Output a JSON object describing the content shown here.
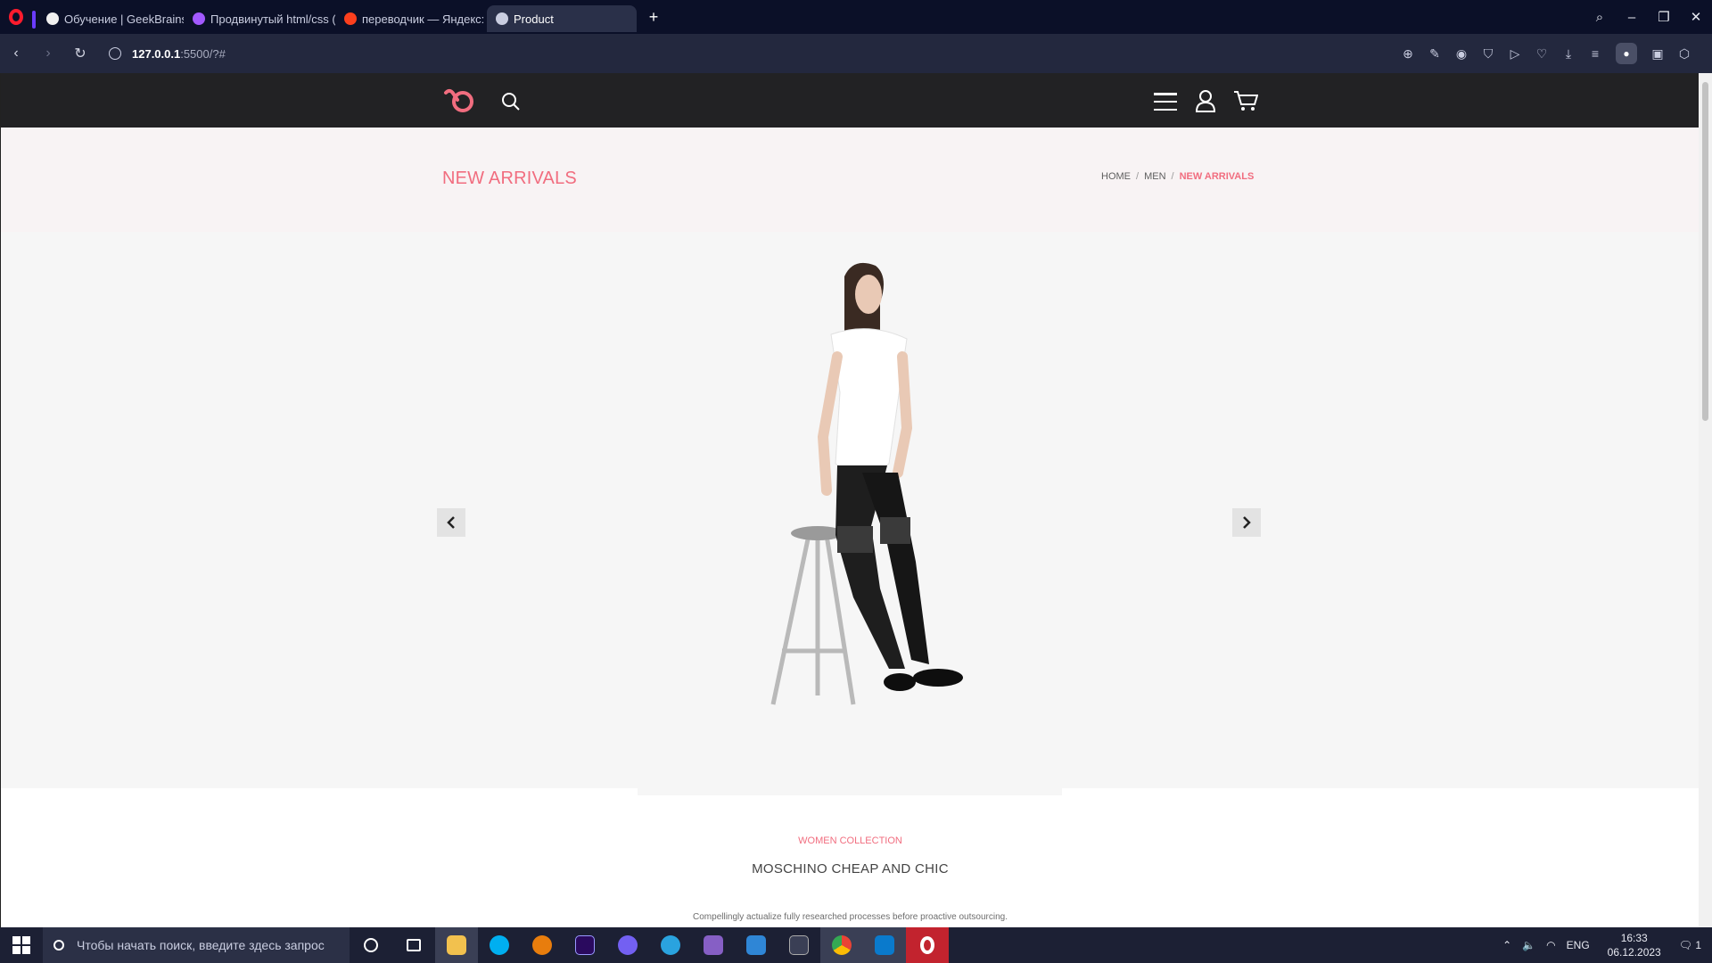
{
  "browser": {
    "tabs": [
      {
        "title": "Обучение | GeekBrains - о",
        "color": "#f0f0f0"
      },
      {
        "title": "Продвинутый html/css (С",
        "color": "#a259ff"
      },
      {
        "title": "переводчик — Яндекс: н",
        "color": "#fc3f1d"
      },
      {
        "title": "Product",
        "color": "#c9cde0",
        "active": true
      }
    ],
    "url_host": "127.0.0.1",
    "url_rest": ":5500/?#",
    "new_tab_label": "+"
  },
  "site": {
    "page_title": "NEW ARRIVALS",
    "breadcrumb": [
      {
        "label": "HOME"
      },
      {
        "label": "MEN"
      },
      {
        "label": "NEW ARRIVALS",
        "current": true
      }
    ],
    "breadcrumb_separator": "/",
    "accent_color": "#f16d7f",
    "header_color": "#222224",
    "hero": {
      "prev_icon": "chevron-left-icon",
      "next_icon": "chevron-right-icon"
    },
    "collection": {
      "label": "WOMEN COLLECTION",
      "title": "MOSCHINO CHEAP AND CHIC",
      "description": "Compellingly actualize fully researched processes before proactive outsourcing."
    }
  },
  "taskbar": {
    "search_placeholder": "Чтобы начать поиск, введите здесь запрос",
    "language": "ENG",
    "time": "16:33",
    "date": "06.12.2023",
    "apps": [
      {
        "name": "cortana-icon",
        "color": "#1c2034"
      },
      {
        "name": "task-view-icon",
        "color": "#1c2034"
      },
      {
        "name": "file-explorer-icon",
        "color": "#f2c14e"
      },
      {
        "name": "skype-icon",
        "color": "#00aff0"
      },
      {
        "name": "blender-like-icon",
        "color": "#e87d0d"
      },
      {
        "name": "premiere-icon",
        "color": "#2a0a5e"
      },
      {
        "name": "viber-icon",
        "color": "#7360f2"
      },
      {
        "name": "telegram-icon",
        "color": "#2aa3df"
      },
      {
        "name": "visual-studio-icon",
        "color": "#865fc5"
      },
      {
        "name": "app-icon",
        "color": "#2f86d6"
      },
      {
        "name": "calculator-icon",
        "color": "#3a3f55"
      },
      {
        "name": "chrome-icon",
        "color": "#34a853"
      },
      {
        "name": "vscode-icon",
        "color": "#0a7acc"
      },
      {
        "name": "opera-icon",
        "color": "#ff1b2d"
      }
    ],
    "notification_count": "1"
  }
}
